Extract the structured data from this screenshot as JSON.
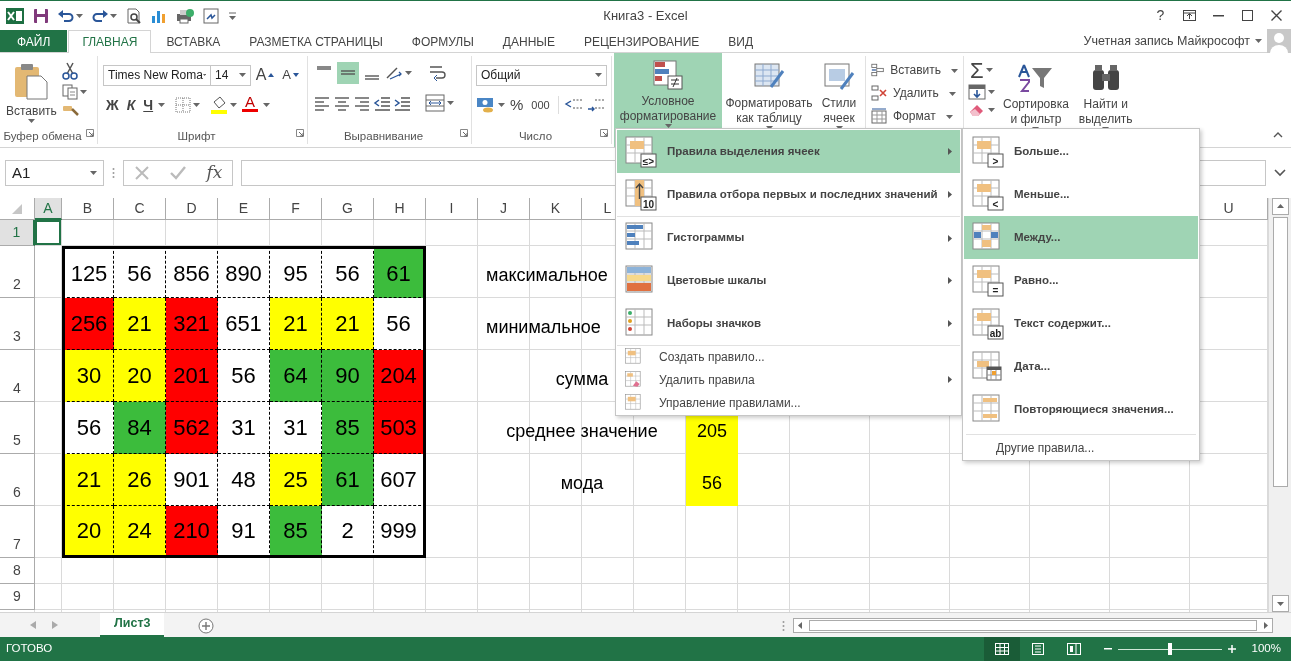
{
  "window": {
    "title": "Книга3 - Excel",
    "help": "?"
  },
  "tabs": [
    {
      "label": "ФАЙЛ",
      "kind": "file",
      "selected": false
    },
    {
      "label": "ГЛАВНАЯ",
      "kind": "tab",
      "selected": true
    },
    {
      "label": "ВСТАВКА",
      "kind": "tab",
      "selected": false
    },
    {
      "label": "РАЗМЕТКА СТРАНИЦЫ",
      "kind": "tab",
      "selected": false
    },
    {
      "label": "ФОРМУЛЫ",
      "kind": "tab",
      "selected": false
    },
    {
      "label": "ДАННЫЕ",
      "kind": "tab",
      "selected": false
    },
    {
      "label": "РЕЦЕНЗИРОВАНИЕ",
      "kind": "tab",
      "selected": false
    },
    {
      "label": "ВИД",
      "kind": "tab",
      "selected": false
    }
  ],
  "account": "Учетная запись Майкрософт",
  "clipboard": {
    "label": "Буфер обмена",
    "paste": "Вставить"
  },
  "font": {
    "label": "Шрифт",
    "font_name": "Times New Roma",
    "font_size": "14",
    "grow": "A",
    "shrink": "A",
    "bold": "Ж",
    "italic": "К",
    "underline": "Ч",
    "font_color": "A"
  },
  "alignment": {
    "label": "Выравнивание",
    "vertical": [
      {
        "selected": false
      },
      {
        "selected": true
      },
      {
        "selected": false
      }
    ]
  },
  "number": {
    "label": "Число",
    "format": "Общий",
    "percent": "%",
    "thousands": "000"
  },
  "styles": {
    "conditional": {
      "lines": [
        "Условное",
        "форматирование"
      ],
      "expanded": true
    },
    "format_table": [
      "Форматировать",
      "как таблицу"
    ],
    "cell_styles": [
      "Стили",
      "ячеек"
    ]
  },
  "cells": {
    "insert": "Вставить",
    "delete": "Удалить",
    "format": "Формат"
  },
  "editing": {
    "sum": "Σ",
    "sort": [
      "Сортировка",
      "и фильтр"
    ],
    "find": [
      "Найти и",
      "выделить"
    ]
  },
  "formula_bar": {
    "name_box": "A1",
    "fx": "fx"
  },
  "sheet": {
    "columns": [
      {
        "label": "A",
        "selected": true
      },
      {
        "label": "B",
        "selected": false
      },
      {
        "label": "C",
        "selected": false
      },
      {
        "label": "D",
        "selected": false
      },
      {
        "label": "E",
        "selected": false
      },
      {
        "label": "F",
        "selected": false
      },
      {
        "label": "G",
        "selected": false
      },
      {
        "label": "H",
        "selected": false
      },
      {
        "label": "I",
        "selected": false
      },
      {
        "label": "J",
        "selected": false
      },
      {
        "label": "K",
        "selected": false
      },
      {
        "label": "L",
        "selected": false
      }
    ],
    "far_columns": [
      {
        "label": "U",
        "selected": false
      }
    ],
    "rows": [
      {
        "label": "1",
        "selected": true
      },
      {
        "label": "2",
        "selected": false
      },
      {
        "label": "3",
        "selected": false
      },
      {
        "label": "4",
        "selected": false
      },
      {
        "label": "5",
        "selected": false
      },
      {
        "label": "6",
        "selected": false
      },
      {
        "label": "7",
        "selected": false
      },
      {
        "label": "8",
        "selected": false
      },
      {
        "label": "9",
        "selected": false
      }
    ]
  },
  "table": {
    "rows": [
      {
        "cells": [
          {
            "text": "125",
            "color": "#ffffff"
          },
          {
            "text": "56",
            "color": "#ffffff"
          },
          {
            "text": "856",
            "color": "#ffffff"
          },
          {
            "text": "890",
            "color": "#ffffff"
          },
          {
            "text": "95",
            "color": "#ffffff"
          },
          {
            "text": "56",
            "color": "#ffffff"
          },
          {
            "text": "61",
            "color": "#3cbc3c"
          }
        ]
      },
      {
        "cells": [
          {
            "text": "256",
            "color": "#ff0000"
          },
          {
            "text": "21",
            "color": "#ffff00"
          },
          {
            "text": "321",
            "color": "#ff0000"
          },
          {
            "text": "651",
            "color": "#ffffff"
          },
          {
            "text": "21",
            "color": "#ffff00"
          },
          {
            "text": "21",
            "color": "#ffff00"
          },
          {
            "text": "56",
            "color": "#ffffff"
          }
        ]
      },
      {
        "cells": [
          {
            "text": "30",
            "color": "#ffff00"
          },
          {
            "text": "20",
            "color": "#ffff00"
          },
          {
            "text": "201",
            "color": "#ff0000"
          },
          {
            "text": "56",
            "color": "#ffffff"
          },
          {
            "text": "64",
            "color": "#3cbc3c"
          },
          {
            "text": "90",
            "color": "#3cbc3c"
          },
          {
            "text": "204",
            "color": "#ff0000"
          }
        ]
      },
      {
        "cells": [
          {
            "text": "56",
            "color": "#ffffff"
          },
          {
            "text": "84",
            "color": "#3cbc3c"
          },
          {
            "text": "562",
            "color": "#ff0000"
          },
          {
            "text": "31",
            "color": "#ffffff"
          },
          {
            "text": "31",
            "color": "#ffffff"
          },
          {
            "text": "85",
            "color": "#3cbc3c"
          },
          {
            "text": "503",
            "color": "#ff0000"
          }
        ]
      },
      {
        "cells": [
          {
            "text": "21",
            "color": "#ffff00"
          },
          {
            "text": "26",
            "color": "#ffff00"
          },
          {
            "text": "901",
            "color": "#ffffff"
          },
          {
            "text": "48",
            "color": "#ffffff"
          },
          {
            "text": "25",
            "color": "#ffff00"
          },
          {
            "text": "61",
            "color": "#3cbc3c"
          },
          {
            "text": "607",
            "color": "#ffffff"
          }
        ]
      },
      {
        "cells": [
          {
            "text": "20",
            "color": "#ffff00"
          },
          {
            "text": "24",
            "color": "#ffff00"
          },
          {
            "text": "210",
            "color": "#ff0000"
          },
          {
            "text": "91",
            "color": "#ffffff"
          },
          {
            "text": "85",
            "color": "#3cbc3c"
          },
          {
            "text": "2",
            "color": "#ffffff"
          },
          {
            "text": "999",
            "color": "#ffffff"
          }
        ]
      }
    ]
  },
  "stats": [
    {
      "kind": "cut",
      "label": "максимальное"
    },
    {
      "kind": "cut",
      "label": "минимальное"
    },
    {
      "kind": "whole",
      "label": "сумма"
    },
    {
      "kind": "whole",
      "label": "среднее значение",
      "value": "205",
      "color": "#ffff00"
    },
    {
      "kind": "whole",
      "label": "мода",
      "value": "56",
      "color": "#ffff00"
    }
  ],
  "conditional_menu": {
    "items": [
      {
        "kind": "big",
        "label": "Правила выделения ячеек",
        "icon_text": "≤>",
        "submenu": true,
        "selected": true
      },
      {
        "kind": "big",
        "label": "Правила отбора первых и последних значений",
        "icon_text": "10",
        "submenu": true,
        "selected": false
      },
      {
        "kind": "big",
        "label": "Гистограммы",
        "submenu": true,
        "selected": false,
        "separator_before": true
      },
      {
        "kind": "big",
        "label": "Цветовые шкалы",
        "submenu": true,
        "selected": false
      },
      {
        "kind": "big",
        "label": "Наборы значков",
        "submenu": true,
        "selected": false
      },
      {
        "kind": "small",
        "label": "Создать правило...",
        "submenu": false,
        "selected": false,
        "separator_before": true
      },
      {
        "kind": "small",
        "label": "Удалить правила",
        "submenu": true,
        "selected": false
      },
      {
        "kind": "small",
        "label": "Управление правилами...",
        "submenu": false,
        "selected": false
      }
    ]
  },
  "rules_submenu": {
    "items": [
      {
        "kind": "rule",
        "label": "Больше...",
        "icon_text": ">",
        "selected": false
      },
      {
        "kind": "rule",
        "label": "Меньше...",
        "icon_text": "<",
        "selected": false
      },
      {
        "kind": "rule",
        "label": "Между...",
        "selected": true
      },
      {
        "kind": "rule",
        "label": "Равно...",
        "icon_text": "=",
        "selected": false
      },
      {
        "kind": "rule",
        "label": "Текст содержит...",
        "icon_text": "ab",
        "selected": false
      },
      {
        "kind": "rule",
        "label": "Дата...",
        "selected": false
      },
      {
        "kind": "rule",
        "label": "Повторяющиеся значения...",
        "selected": false
      },
      {
        "kind": "plain",
        "label": "Другие правила...",
        "selected": false
      }
    ]
  },
  "sheet_tabs": [
    {
      "label": "Лист3",
      "selected": true
    }
  ],
  "status_bar": {
    "text": "ГОТОВО",
    "views": [
      {
        "selected": true
      },
      {
        "selected": false
      },
      {
        "selected": false
      }
    ],
    "zoom": {
      "level": 0.5,
      "reading": "100%"
    }
  }
}
